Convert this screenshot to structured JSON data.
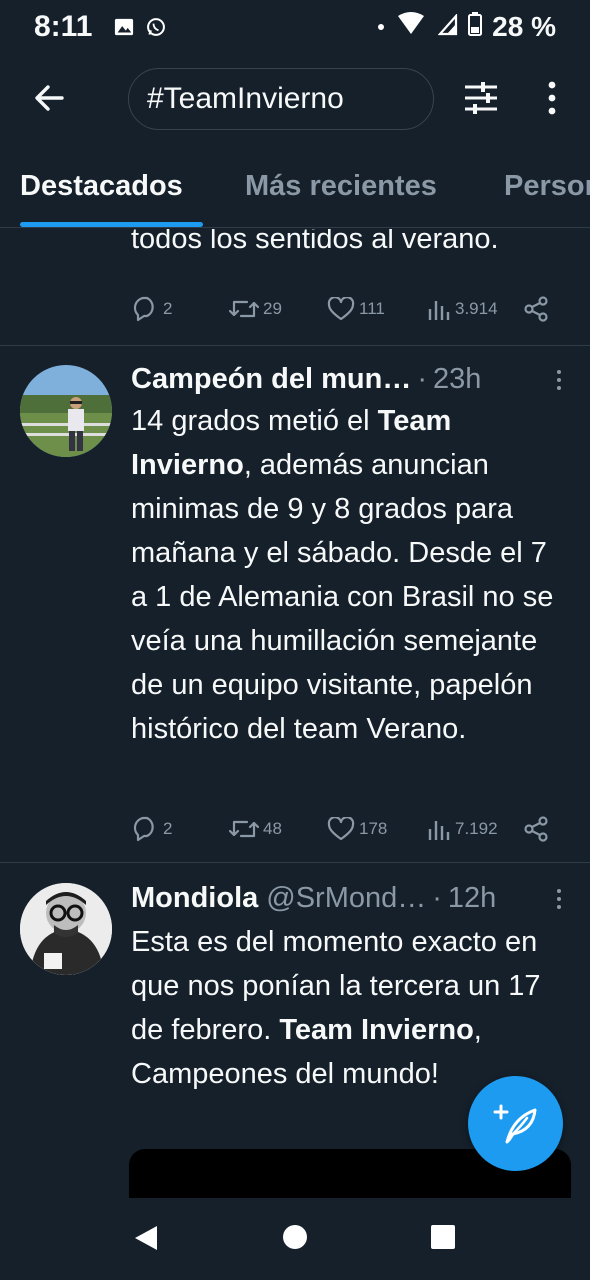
{
  "status_bar": {
    "time": "8:11",
    "battery": "28 %"
  },
  "search": {
    "query": "#TeamInvierno"
  },
  "tabs": [
    {
      "label": "Destacados",
      "active": true
    },
    {
      "label": "Más recientes",
      "active": false
    },
    {
      "label": "Personas",
      "active": false
    }
  ],
  "tweets": [
    {
      "partial": true,
      "text_tail": "todos los sentidos al verano.",
      "replies": "2",
      "retweets": "29",
      "likes": "111",
      "views": "3.914"
    },
    {
      "author": "Campeón del mun…",
      "time": "23h",
      "text_parts": [
        {
          "t": "14 grados metió el ",
          "b": false
        },
        {
          "t": "Team Invierno",
          "b": true
        },
        {
          "t": ", además anuncian minimas de 9 y 8 grados para mañana y el sábado. Desde el 7 a 1 de Alemania con Brasil no se veía una humillación semejante de un equipo visitante, papelón histórico del team Verano.",
          "b": false
        }
      ],
      "replies": "2",
      "retweets": "48",
      "likes": "178",
      "views": "7.192"
    },
    {
      "author": "Mondiola",
      "handle": "@SrMond…",
      "time": "12h",
      "text_parts": [
        {
          "t": "Esta es del momento exacto en que nos ponían la tercera un 17 de febrero. ",
          "b": false
        },
        {
          "t": "Team Invierno",
          "b": true
        },
        {
          "t": ", Campeones del mundo!",
          "b": false
        }
      ]
    }
  ],
  "colors": {
    "background": "#15202b",
    "accent": "#1d9bf0",
    "secondary_text": "#8b98a5"
  },
  "icons": [
    "back-arrow-icon",
    "filter-icon",
    "more-vertical-icon",
    "reply-icon",
    "retweet-icon",
    "like-icon",
    "views-icon",
    "share-icon",
    "compose-icon"
  ]
}
